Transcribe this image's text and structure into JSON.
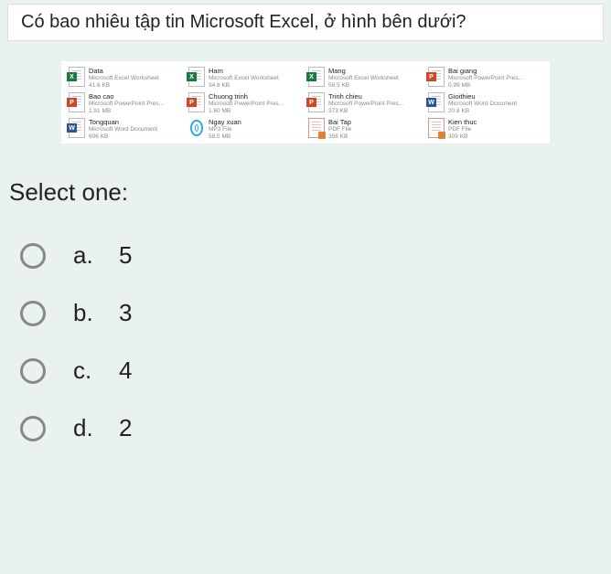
{
  "question": "Có bao nhiêu tập tin Microsoft Excel, ở hình bên dưới?",
  "files": [
    {
      "name": "Data",
      "type": "Microsoft Excel Worksheet",
      "size": "41.6 KB",
      "app": "excel",
      "glyph": "X"
    },
    {
      "name": "Ham",
      "type": "Microsoft Excel Worksheet",
      "size": "34.8 KB",
      "app": "excel",
      "glyph": "X"
    },
    {
      "name": "Mang",
      "type": "Microsoft Excel Worksheet",
      "size": "58.5 KB",
      "app": "excel",
      "glyph": "X"
    },
    {
      "name": "Bai giang",
      "type": "Microsoft PowerPoint Pres...",
      "size": "0.99 MB",
      "app": "ppt",
      "glyph": "P"
    },
    {
      "name": "Bao cao",
      "type": "Microsoft PowerPoint Pres...",
      "size": "1.91 MB",
      "app": "ppt",
      "glyph": "P"
    },
    {
      "name": "Chuong trinh",
      "type": "Microsoft PowerPoint Pres...",
      "size": "1.60 MB",
      "app": "ppt",
      "glyph": "P"
    },
    {
      "name": "Trinh chieu",
      "type": "Microsoft PowerPoint Pres...",
      "size": "373 KB",
      "app": "ppt",
      "glyph": "P"
    },
    {
      "name": "Gioithieu",
      "type": "Microsoft Word Document",
      "size": "20.8 KB",
      "app": "word",
      "glyph": "W"
    },
    {
      "name": "Tongquan",
      "type": "Microsoft Word Document",
      "size": "606 KB",
      "app": "word",
      "glyph": "W"
    },
    {
      "name": "Ngay xuan",
      "type": "MP3 File",
      "size": "58.5 MB",
      "app": "mp3",
      "glyph": ""
    },
    {
      "name": "Bai Tap",
      "type": "PDF File",
      "size": "356 KB",
      "app": "pdf",
      "glyph": ""
    },
    {
      "name": "Kien thuc",
      "type": "PDF File",
      "size": "309 KB",
      "app": "pdf",
      "glyph": ""
    }
  ],
  "select_label": "Select one:",
  "options": [
    {
      "letter": "a.",
      "text": "5"
    },
    {
      "letter": "b.",
      "text": "3"
    },
    {
      "letter": "c.",
      "text": "4"
    },
    {
      "letter": "d.",
      "text": "2"
    }
  ]
}
